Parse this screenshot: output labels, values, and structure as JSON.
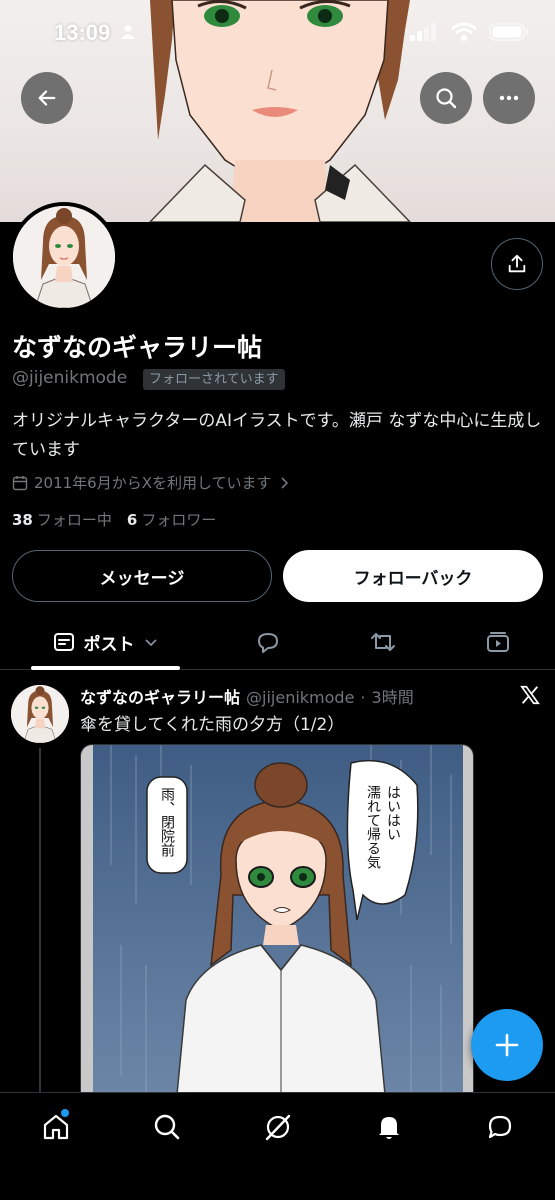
{
  "status_bar": {
    "time": "13:09"
  },
  "profile": {
    "display_name": "なずなのギャラリー帖",
    "handle": "@jijenikmode",
    "follows_you_badge": "フォローされています",
    "bio": "オリジナルキャラクターのAIイラストです。瀬戸 なずな中心に生成しています",
    "joined": "2011年6月からXを利用しています",
    "following_count": "38",
    "following_label": "フォロー中",
    "followers_count": "6",
    "followers_label": "フォロワー",
    "message_button": "メッセージ",
    "follow_back_button": "フォローバック"
  },
  "tabs": {
    "posts_label": "ポスト"
  },
  "post": {
    "author_name": "なずなのギャラリー帖",
    "author_handle": "@jijenikmode",
    "dot": "·",
    "time": "3時間",
    "text": "傘を貸してくれた雨の夕方（1/2）",
    "image_bubble_left": "雨、閉院前",
    "image_bubble_right_col1": "はいはい",
    "image_bubble_right_col2": "濡れて帰る気"
  },
  "colors": {
    "accent": "#1d9bf0",
    "background": "#000000",
    "muted_text": "#71767b",
    "border": "#2f3336"
  },
  "icons": {
    "back": "arrow-left-icon",
    "search": "search-icon",
    "more": "more-horizontal-icon",
    "share": "share-icon",
    "calendar": "calendar-icon",
    "fab": "plus-icon",
    "nav": [
      "home-icon",
      "search-icon",
      "grok-icon",
      "bell-icon",
      "chat-icon"
    ]
  }
}
